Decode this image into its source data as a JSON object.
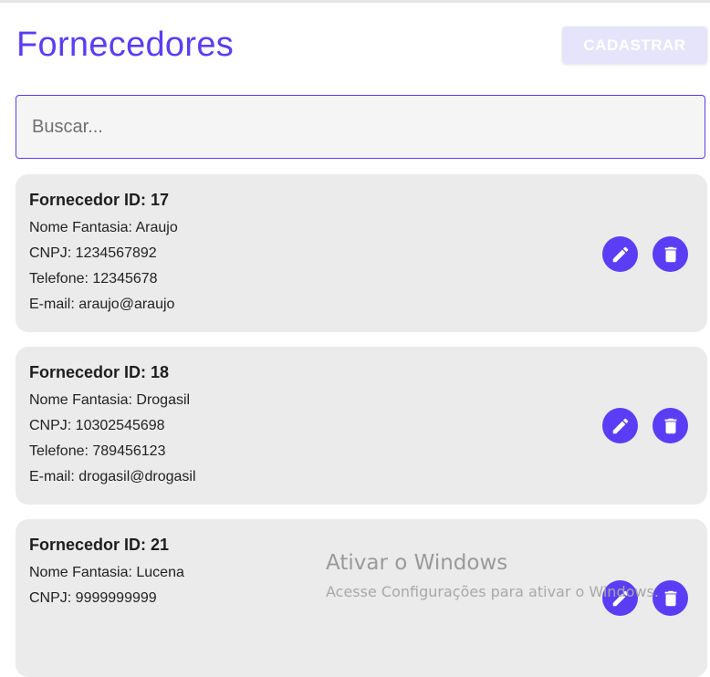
{
  "header": {
    "title": "Fornecedores",
    "register_label": "CADASTRAR"
  },
  "search": {
    "placeholder": "Buscar..."
  },
  "suppliers": [
    {
      "title": "Fornecedor ID: 17",
      "nome_fantasia": "Nome Fantasia: Araujo",
      "cnpj": "CNPJ: 1234567892",
      "telefone": "Telefone: 12345678",
      "email": "E-mail: araujo@araujo"
    },
    {
      "title": "Fornecedor ID: 18",
      "nome_fantasia": "Nome Fantasia: Drogasil",
      "cnpj": "CNPJ: 10302545698",
      "telefone": "Telefone: 789456123",
      "email": "E-mail: drogasil@drogasil"
    },
    {
      "title": "Fornecedor ID: 21",
      "nome_fantasia": "Nome Fantasia: Lucena",
      "cnpj": "CNPJ: 9999999999",
      "telefone": "",
      "email": ""
    }
  ],
  "icons": {
    "edit": "pencil-icon",
    "delete": "trash-icon"
  },
  "colors": {
    "accent": "#5b3df5",
    "card_bg": "#ebebeb",
    "register_button_bg": "#e6e4fb"
  },
  "watermark": {
    "title": "Ativar o Windows",
    "subtitle": "Acesse Configurações para ativar o Windows."
  }
}
